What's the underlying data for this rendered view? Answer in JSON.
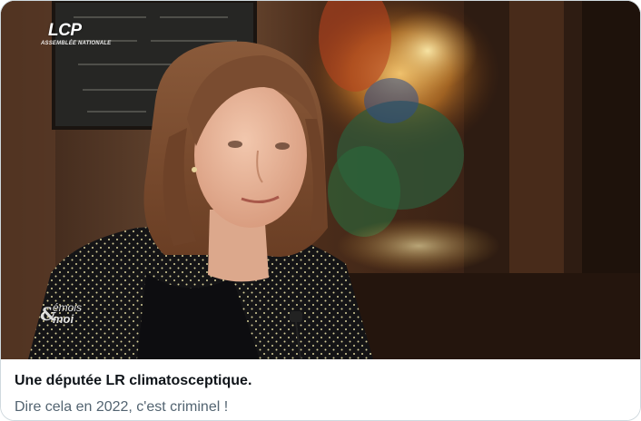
{
  "media": {
    "channel_logo": "LCP",
    "channel_subtitle": "ASSEMBLÉE NATIONALE",
    "show_logo_top": "émois",
    "show_logo_amp": "&",
    "show_logo_bottom": "moi"
  },
  "card": {
    "title": "Une députée LR climatosceptique.",
    "description": "Dire cela en 2022, c'est criminel !"
  },
  "colors": {
    "title": "#0f1419",
    "description": "#536471",
    "border": "#cfd9de"
  }
}
